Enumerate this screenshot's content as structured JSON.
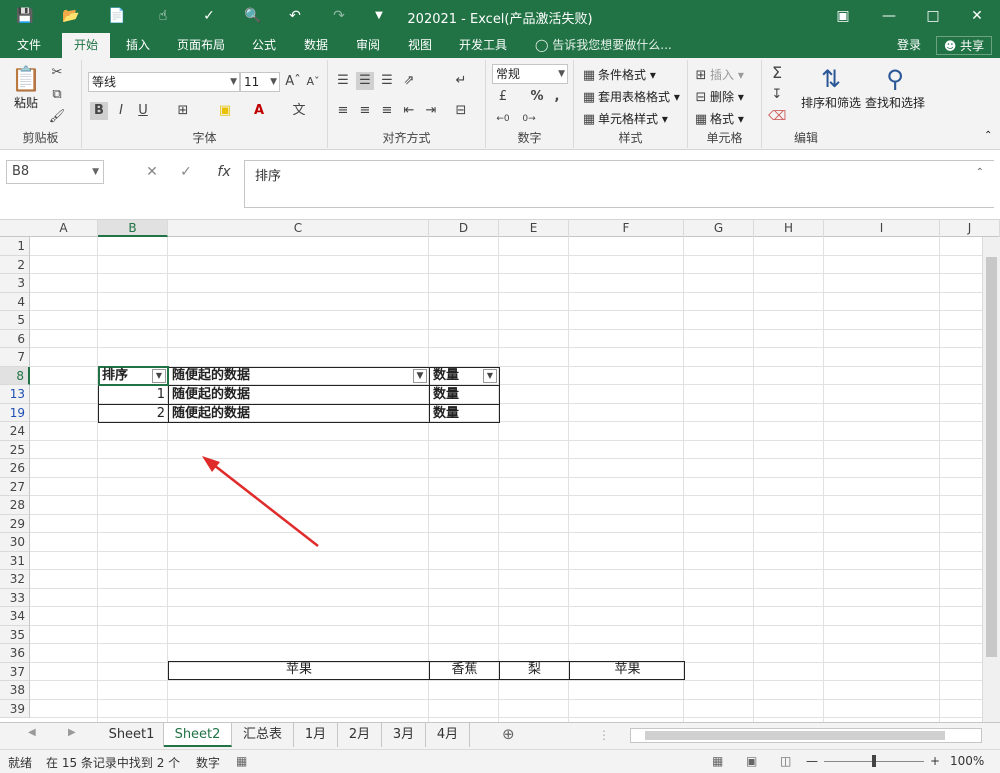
{
  "window": {
    "title": "202021 - Excel(产品激活失败)"
  },
  "tabs": [
    "文件",
    "开始",
    "插入",
    "页面布局",
    "公式",
    "数据",
    "审阅",
    "视图",
    "开发工具"
  ],
  "active_tab": "开始",
  "tell_me": "告诉我您想要做什么...",
  "account": {
    "login": "登录",
    "share": "共享"
  },
  "ribbon": {
    "clipboard": {
      "label": "剪贴板",
      "paste": "粘贴"
    },
    "font": {
      "label": "字体",
      "font_name": "等线",
      "font_size": "11",
      "bold": "B",
      "italic": "I",
      "underline": "U"
    },
    "alignment": {
      "label": "对齐方式"
    },
    "number": {
      "label": "数字",
      "format": "常规",
      "percent": "%",
      "comma": ","
    },
    "styles": {
      "label": "样式",
      "conditional": "条件格式",
      "table": "套用表格格式",
      "cell_styles": "单元格样式"
    },
    "cells": {
      "label": "单元格",
      "insert": "插入",
      "delete": "删除",
      "format": "格式"
    },
    "editing": {
      "label": "编辑",
      "sort_filter": "排序和筛选",
      "find_select": "查找和选择"
    }
  },
  "formula_bar": {
    "name_box": "B8",
    "fx": "fx",
    "content": "排序"
  },
  "columns": [
    "A",
    "B",
    "C",
    "D",
    "E",
    "F",
    "G",
    "H",
    "I",
    "J"
  ],
  "selected_column": "B",
  "rows": [
    "1",
    "2",
    "3",
    "4",
    "5",
    "6",
    "7",
    "8",
    "13",
    "19",
    "24",
    "25",
    "26",
    "27",
    "28",
    "29",
    "30",
    "31",
    "32",
    "33",
    "34",
    "35",
    "36",
    "37",
    "38",
    "39"
  ],
  "filtered_rows": [
    "13",
    "19"
  ],
  "selected_row": "8",
  "table": {
    "header": [
      "排序",
      "随便起的数据",
      "数量"
    ],
    "rows": [
      [
        "1",
        "随便起的数据",
        "数量"
      ],
      [
        "2",
        "随便起的数据",
        "数量"
      ]
    ]
  },
  "row37": [
    "苹果",
    "香蕉",
    "梨",
    "苹果"
  ],
  "sheets": [
    "Sheet1",
    "Sheet2",
    "汇总表",
    "1月",
    "2月",
    "3月",
    "4月"
  ],
  "active_sheet": "Sheet2",
  "status": {
    "mode": "就绪",
    "records": "在 15 条记录中找到 2 个",
    "number_mode": "数字",
    "zoom": "100%"
  },
  "colors": {
    "accent": "#217346",
    "arrow": "#e02b2b",
    "filtered_row": "#1f4fb4"
  }
}
